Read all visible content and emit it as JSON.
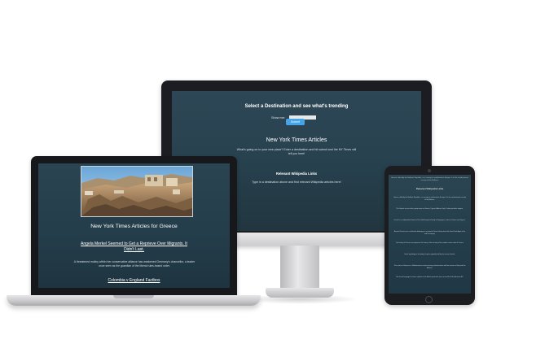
{
  "desktop": {
    "title": "Select a Destination and see what's trending",
    "show_label": "Show me:",
    "submit_label": "Submit",
    "heading": "New York Times Articles",
    "intro": "What's going on in your new place? Enter a destination and hit submit and the NY Times will tell you here!",
    "wiki_heading": "Relevant Wikipedia Links",
    "wiki_text": "Type in a destination above and find relevant Wikipedia articles here!"
  },
  "laptop": {
    "heading": "New York Times Articles for Greece",
    "article_link": "Angela Merkel Seemed to Get a Reprieve Over Migrants. It Didn't Last.",
    "article_summary": "A threatened mutiny within her conservative alliance has weakened Germany's chancellor, a leader once seen as the guardian of the liberal rules-based order.",
    "second_link": "Colombia v England Factbox"
  },
  "tablet": {
    "top_text": "Greece, officially the Hellenic Republic, is a country in southeastern Europe. It is the southernmost country of the Balkans.",
    "heading": "Relevant Wikipedia Links",
    "items": [
      "Greece, officially the Hellenic Republic, is a country in southeastern Europe. It is the southernmost country of the Balkans.",
      "The Greeks are an ethnic group native to Greece, Cyprus, Albania, Italy, Turkey and other regions.",
      "Greek is an independent branch of the Indo-European family of languages, native to Greece and Cyprus.",
      "Ancient Greece was a civilization belonging to a period of Greek history from the Greek Dark Ages to the end of antiquity.",
      "The history of Greece encompasses the history of the territory of the modern nation state of Greece.",
      "Greek mythology is the body of myths originally told by the ancient Greeks.",
      "The cuisine of Greece is a Mediterranean cuisine sharing characteristics with the cuisines of Italy and the Balkans.",
      "The Greek language has been spoken in the Balkan peninsula since around the 3rd millennium BC."
    ]
  }
}
